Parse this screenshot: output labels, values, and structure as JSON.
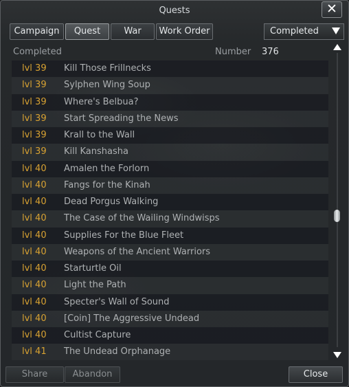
{
  "window": {
    "title": "Quests"
  },
  "tabs": [
    {
      "label": "Campaign",
      "active": false
    },
    {
      "label": "Quest",
      "active": true
    },
    {
      "label": "War",
      "active": false
    },
    {
      "label": "Work Order",
      "active": false
    }
  ],
  "filter": {
    "selected": "Completed"
  },
  "list_header": {
    "completed_label": "Completed",
    "number_label": "Number",
    "count": "376"
  },
  "quests": [
    {
      "level": "lvl 39",
      "name": "Kill Those Frillnecks"
    },
    {
      "level": "lvl 39",
      "name": "Sylphen Wing Soup"
    },
    {
      "level": "lvl 39",
      "name": "Where's Belbua?"
    },
    {
      "level": "lvl 39",
      "name": "Start Spreading the News"
    },
    {
      "level": "lvl 39",
      "name": "Krall to the Wall"
    },
    {
      "level": "lvl 39",
      "name": "Kill Kanshasha"
    },
    {
      "level": "lvl 40",
      "name": "Amalen the Forlorn"
    },
    {
      "level": "lvl 40",
      "name": "Fangs for the Kinah"
    },
    {
      "level": "lvl 40",
      "name": "Dead Porgus Walking"
    },
    {
      "level": "lvl 40",
      "name": "The Case of the Wailing Windwisps"
    },
    {
      "level": "lvl 40",
      "name": "Supplies For the Blue Fleet"
    },
    {
      "level": "lvl 40",
      "name": "Weapons of the Ancient Warriors"
    },
    {
      "level": "lvl 40",
      "name": "Starturtle Oil"
    },
    {
      "level": "lvl 40",
      "name": "Light the Path"
    },
    {
      "level": "lvl 40",
      "name": "Specter's Wall of Sound"
    },
    {
      "level": "lvl 40",
      "name": "[Coin] The Aggressive Undead"
    },
    {
      "level": "lvl 40",
      "name": "Cultist Capture"
    },
    {
      "level": "lvl 41",
      "name": "The Undead Orphanage"
    }
  ],
  "buttons": {
    "share": "Share",
    "abandon": "Abandon",
    "close": "Close"
  },
  "icons": {
    "close": "close-icon",
    "dropdown": "chevron-down-icon",
    "scroll_up": "scroll-up-icon",
    "scroll_down": "scroll-down-icon"
  },
  "colors": {
    "level_text": "#d8a232",
    "quest_text": "#aeb1b3"
  },
  "scroll": {
    "position_fraction": 0.57
  }
}
